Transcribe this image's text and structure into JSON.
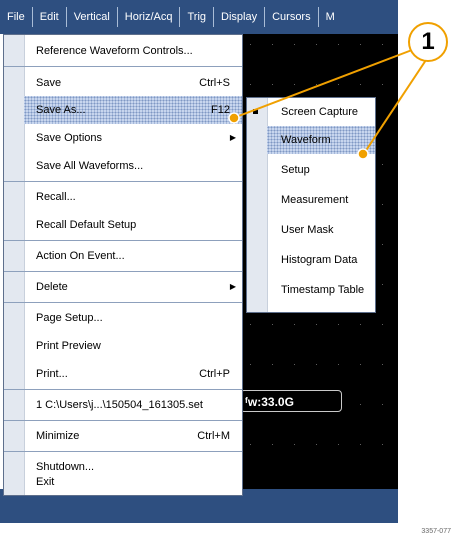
{
  "menubar": {
    "items": [
      "File",
      "Edit",
      "Vertical",
      "Horiz/Acq",
      "Trig",
      "Display",
      "Cursors",
      "M"
    ]
  },
  "file_menu": {
    "items": [
      {
        "label": "Reference Waveform Controls...",
        "shortcut": "",
        "submenu": false
      },
      {
        "label": "Save",
        "shortcut": "Ctrl+S",
        "submenu": false
      },
      {
        "label": "Save As...",
        "shortcut": "F12",
        "submenu": false,
        "highlighted": true
      },
      {
        "label": "Save Options",
        "shortcut": "",
        "submenu": true
      },
      {
        "label": "Save All Waveforms...",
        "shortcut": "",
        "submenu": false
      },
      {
        "label": "Recall...",
        "shortcut": "",
        "submenu": false
      },
      {
        "label": "Recall Default Setup",
        "shortcut": "",
        "submenu": false
      },
      {
        "label": "Action On Event...",
        "shortcut": "",
        "submenu": false
      },
      {
        "label": "Delete",
        "shortcut": "",
        "submenu": true
      },
      {
        "label": "Page Setup...",
        "shortcut": "",
        "submenu": false
      },
      {
        "label": "Print Preview",
        "shortcut": "",
        "submenu": false
      },
      {
        "label": "Print...",
        "shortcut": "Ctrl+P",
        "submenu": false
      },
      {
        "label": "1 C:\\Users\\j...\\150504_161305.set",
        "shortcut": "",
        "submenu": false
      },
      {
        "label": "Minimize",
        "shortcut": "Ctrl+M",
        "submenu": false
      },
      {
        "label": "Shutdown...",
        "shortcut": "",
        "submenu": false
      },
      {
        "label": "Exit",
        "shortcut": "",
        "submenu": false
      }
    ]
  },
  "save_as_submenu": {
    "items": [
      "Screen Capture",
      "Waveform",
      "Setup",
      "Measurement",
      "User Mask",
      "Histogram Data",
      "Timestamp Table"
    ],
    "selected": "Screen Capture",
    "highlighted": "Waveform"
  },
  "scope": {
    "readout": "ᶠw:33.0G"
  },
  "callout": {
    "number": "1",
    "color": "#f0a000"
  },
  "figure_id": "3357-077",
  "colors": {
    "menubar": "#2e4f80",
    "highlight": "#c8d6ee",
    "scope_bg": "#000000"
  }
}
